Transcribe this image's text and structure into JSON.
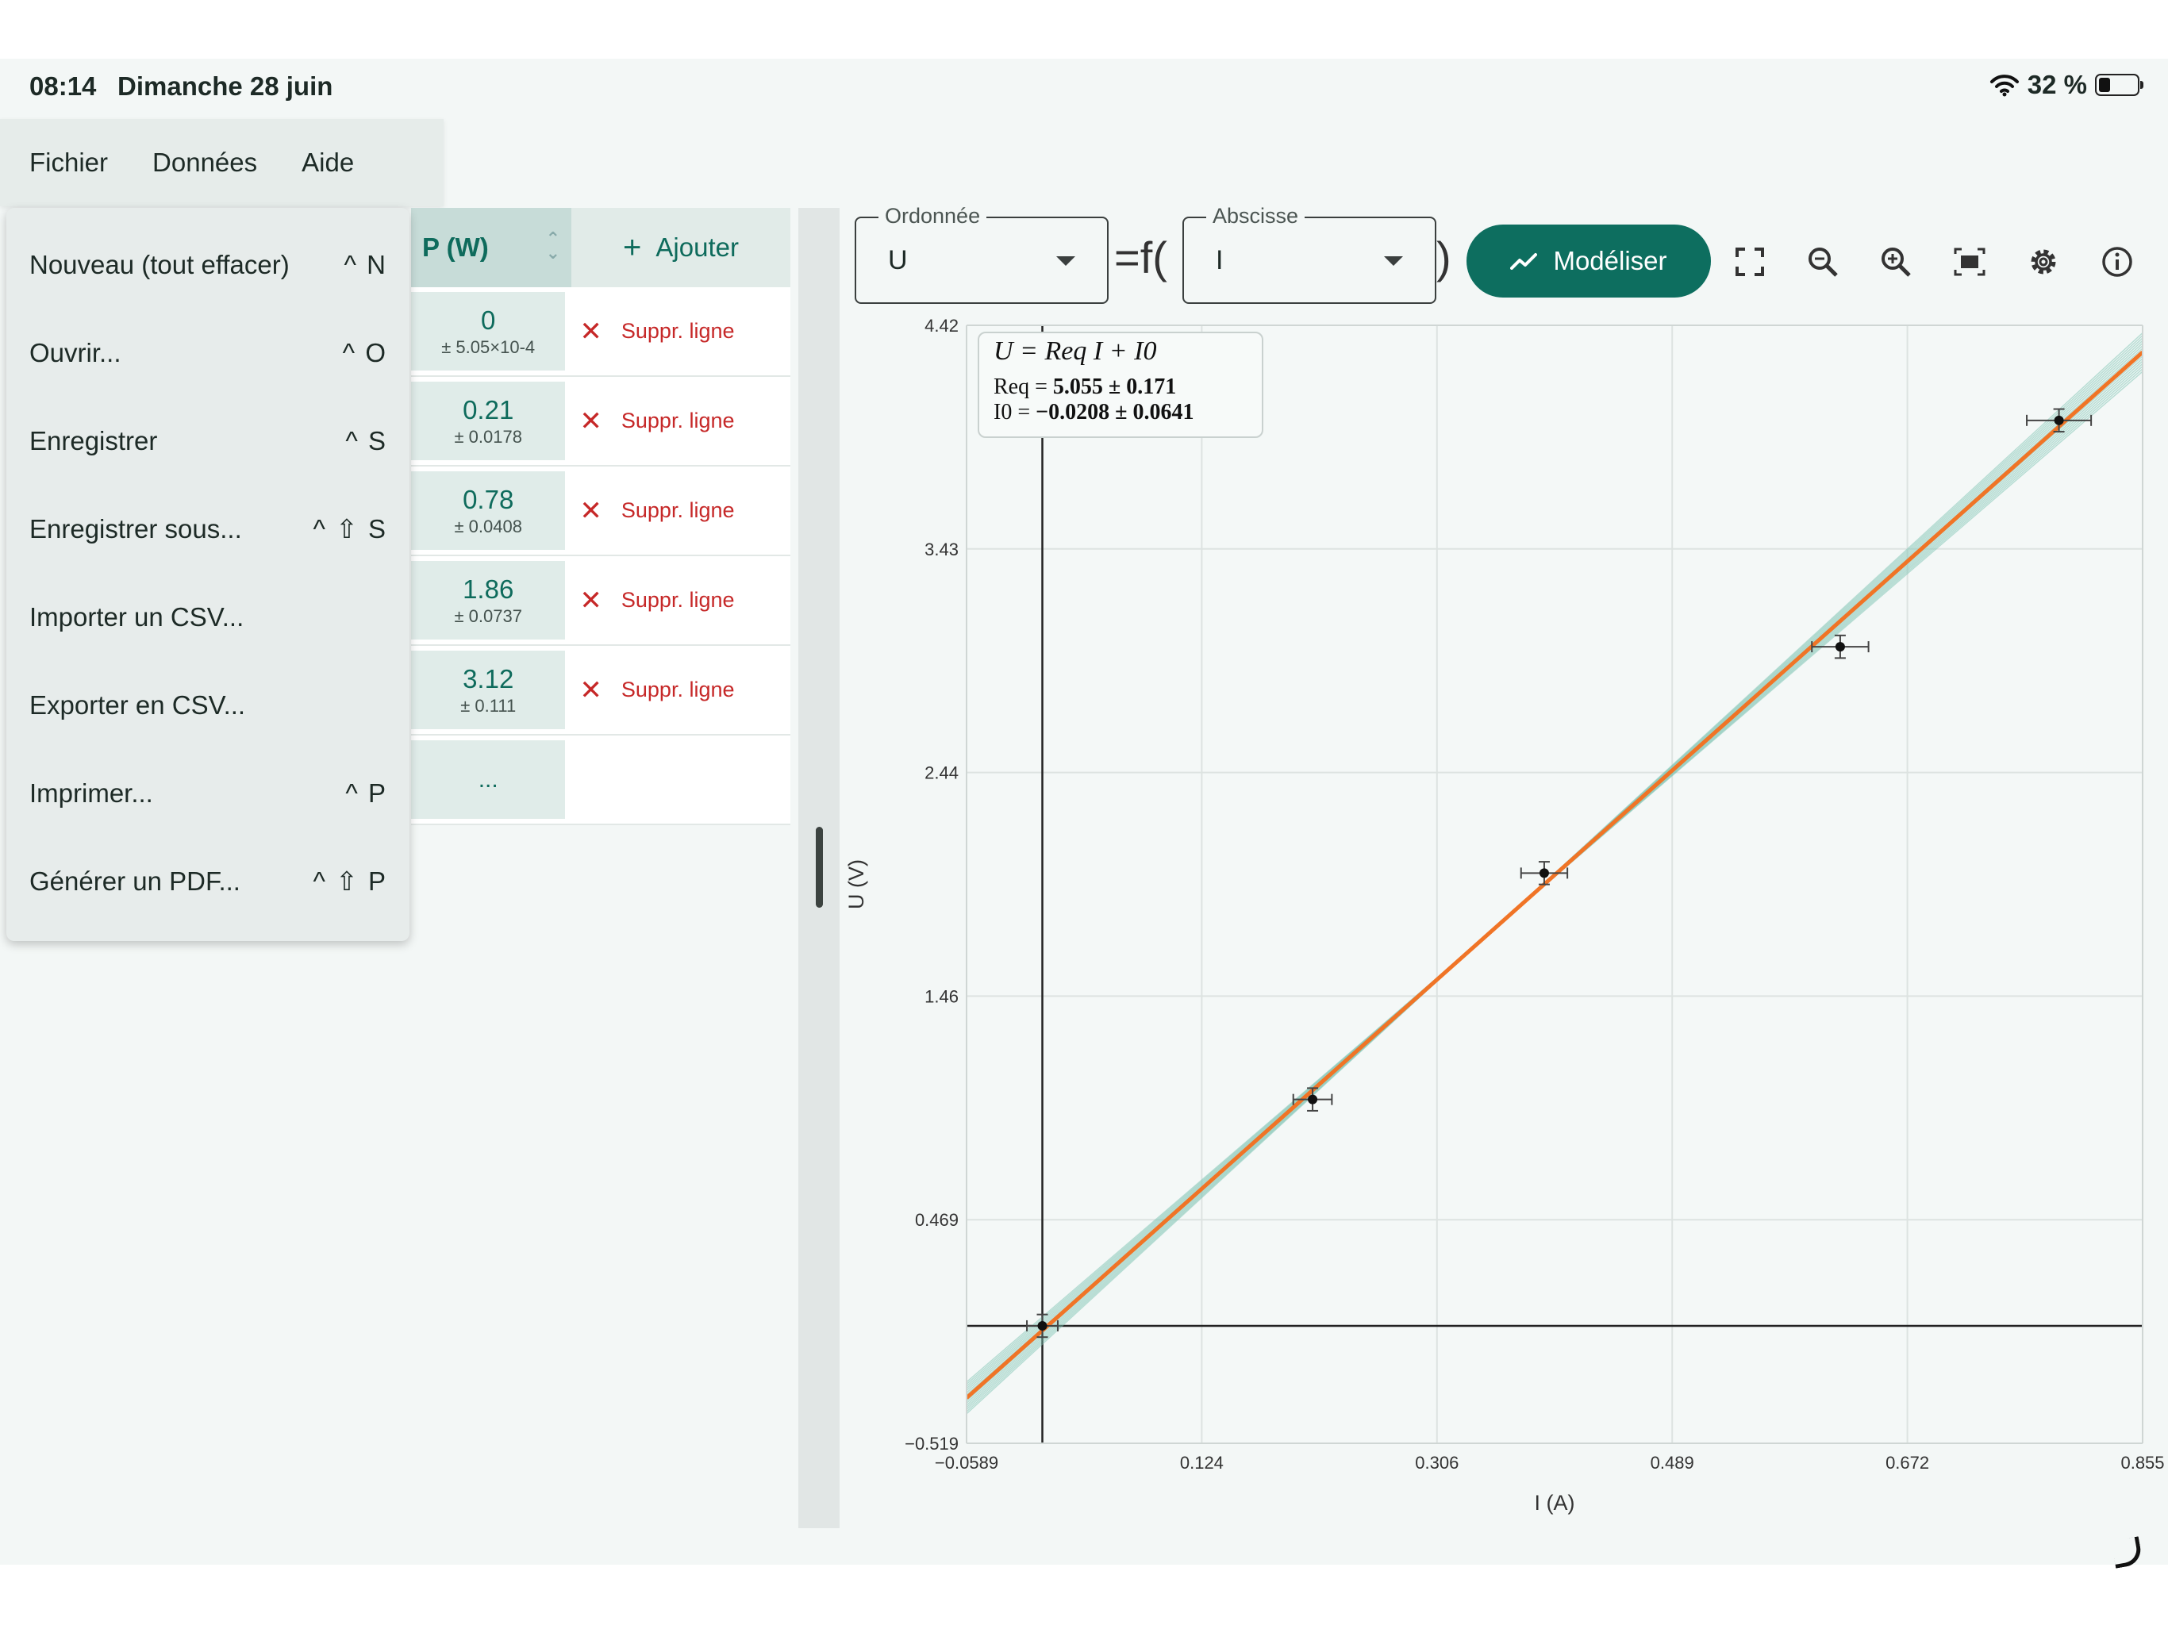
{
  "status": {
    "time": "08:14",
    "date": "Dimanche 28 juin",
    "battery": "32 %",
    "battery_level": 0.32
  },
  "menubar": {
    "items": [
      "Fichier",
      "Données",
      "Aide"
    ]
  },
  "file_menu": {
    "items": [
      {
        "label": "Nouveau (tout effacer)",
        "shortcut": "^ N"
      },
      {
        "label": "Ouvrir...",
        "shortcut": "^ O"
      },
      {
        "label": "Enregistrer",
        "shortcut": "^ S"
      },
      {
        "label": "Enregistrer sous...",
        "shortcut": "^ ⇧ S"
      },
      {
        "label": "Importer un CSV...",
        "shortcut": ""
      },
      {
        "label": "Exporter en CSV...",
        "shortcut": ""
      },
      {
        "label": "Imprimer...",
        "shortcut": "^ P"
      },
      {
        "label": "Générer un PDF...",
        "shortcut": "^ ⇧ P"
      }
    ]
  },
  "table": {
    "column_header": "P (W)",
    "add_label": "Ajouter",
    "delete_label": "Suppr. ligne",
    "rows": [
      {
        "value": "0",
        "uncertainty": "± 5.05×10-4"
      },
      {
        "value": "0.21",
        "uncertainty": "± 0.0178"
      },
      {
        "value": "0.78",
        "uncertainty": "± 0.0408"
      },
      {
        "value": "1.86",
        "uncertainty": "± 0.0737"
      },
      {
        "value": "3.12",
        "uncertainty": "± 0.111"
      }
    ],
    "more_label": "..."
  },
  "toolbar": {
    "ordinate_label": "Ordonnée",
    "ordinate_value": "U",
    "equals_f": "=f(",
    "close_paren": ")",
    "abscissa_label": "Abscisse",
    "abscissa_value": "I",
    "model_button": "Modéliser",
    "icons": [
      "fullscreen-icon",
      "zoom-out-icon",
      "zoom-in-icon",
      "fit-view-icon",
      "settings-icon",
      "info-icon"
    ]
  },
  "legend": {
    "equation": "U = Req I + I0",
    "param1_name": "Req",
    "param1_value": "5.055 ± 0.171",
    "param2_name": "I0",
    "param2_value": "−0.0208 ± 0.0641"
  },
  "colors": {
    "accent": "#0d6e5f",
    "fit_line": "#f07426",
    "uncertainty_lines": "#7ec4b3",
    "delete": "#c62828"
  },
  "chart_data": {
    "type": "scatter",
    "xlabel": "I (A)",
    "ylabel": "U (V)",
    "xlim": [
      -0.0589,
      0.855
    ],
    "ylim": [
      -0.519,
      4.42
    ],
    "x_ticks": [
      "-0.0589",
      "0.124",
      "0.306",
      "0.489",
      "0.672",
      "0.855"
    ],
    "y_ticks": [
      "-0.519",
      "0.469",
      "1.46",
      "2.44",
      "3.43",
      "4.42"
    ],
    "grid": true,
    "points": [
      {
        "x": 0.0,
        "y": 0.0,
        "xerr": 0.012,
        "yerr": 0.05
      },
      {
        "x": 0.21,
        "y": 1.0,
        "xerr": 0.015,
        "yerr": 0.05
      },
      {
        "x": 0.39,
        "y": 2.0,
        "xerr": 0.018,
        "yerr": 0.05
      },
      {
        "x": 0.62,
        "y": 3.0,
        "xerr": 0.022,
        "yerr": 0.05
      },
      {
        "x": 0.79,
        "y": 4.0,
        "xerr": 0.025,
        "yerr": 0.05
      }
    ],
    "fit": {
      "slope": 5.055,
      "intercept": -0.0208
    }
  }
}
